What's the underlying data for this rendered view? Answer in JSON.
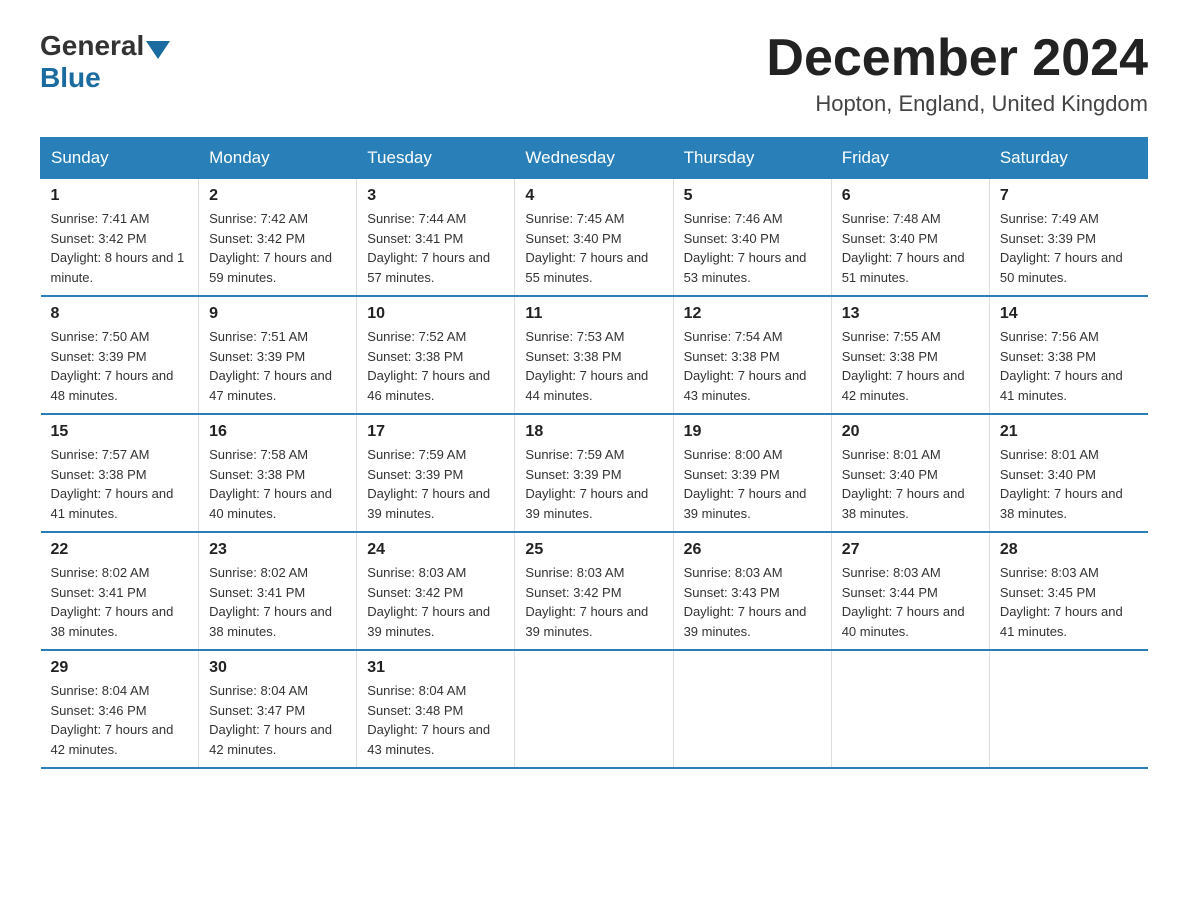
{
  "header": {
    "logo_general": "General",
    "logo_blue": "Blue",
    "month_title": "December 2024",
    "location": "Hopton, England, United Kingdom"
  },
  "days_of_week": [
    "Sunday",
    "Monday",
    "Tuesday",
    "Wednesday",
    "Thursday",
    "Friday",
    "Saturday"
  ],
  "weeks": [
    [
      {
        "day": "1",
        "sunrise": "7:41 AM",
        "sunset": "3:42 PM",
        "daylight": "8 hours and 1 minute."
      },
      {
        "day": "2",
        "sunrise": "7:42 AM",
        "sunset": "3:42 PM",
        "daylight": "7 hours and 59 minutes."
      },
      {
        "day": "3",
        "sunrise": "7:44 AM",
        "sunset": "3:41 PM",
        "daylight": "7 hours and 57 minutes."
      },
      {
        "day": "4",
        "sunrise": "7:45 AM",
        "sunset": "3:40 PM",
        "daylight": "7 hours and 55 minutes."
      },
      {
        "day": "5",
        "sunrise": "7:46 AM",
        "sunset": "3:40 PM",
        "daylight": "7 hours and 53 minutes."
      },
      {
        "day": "6",
        "sunrise": "7:48 AM",
        "sunset": "3:40 PM",
        "daylight": "7 hours and 51 minutes."
      },
      {
        "day": "7",
        "sunrise": "7:49 AM",
        "sunset": "3:39 PM",
        "daylight": "7 hours and 50 minutes."
      }
    ],
    [
      {
        "day": "8",
        "sunrise": "7:50 AM",
        "sunset": "3:39 PM",
        "daylight": "7 hours and 48 minutes."
      },
      {
        "day": "9",
        "sunrise": "7:51 AM",
        "sunset": "3:39 PM",
        "daylight": "7 hours and 47 minutes."
      },
      {
        "day": "10",
        "sunrise": "7:52 AM",
        "sunset": "3:38 PM",
        "daylight": "7 hours and 46 minutes."
      },
      {
        "day": "11",
        "sunrise": "7:53 AM",
        "sunset": "3:38 PM",
        "daylight": "7 hours and 44 minutes."
      },
      {
        "day": "12",
        "sunrise": "7:54 AM",
        "sunset": "3:38 PM",
        "daylight": "7 hours and 43 minutes."
      },
      {
        "day": "13",
        "sunrise": "7:55 AM",
        "sunset": "3:38 PM",
        "daylight": "7 hours and 42 minutes."
      },
      {
        "day": "14",
        "sunrise": "7:56 AM",
        "sunset": "3:38 PM",
        "daylight": "7 hours and 41 minutes."
      }
    ],
    [
      {
        "day": "15",
        "sunrise": "7:57 AM",
        "sunset": "3:38 PM",
        "daylight": "7 hours and 41 minutes."
      },
      {
        "day": "16",
        "sunrise": "7:58 AM",
        "sunset": "3:38 PM",
        "daylight": "7 hours and 40 minutes."
      },
      {
        "day": "17",
        "sunrise": "7:59 AM",
        "sunset": "3:39 PM",
        "daylight": "7 hours and 39 minutes."
      },
      {
        "day": "18",
        "sunrise": "7:59 AM",
        "sunset": "3:39 PM",
        "daylight": "7 hours and 39 minutes."
      },
      {
        "day": "19",
        "sunrise": "8:00 AM",
        "sunset": "3:39 PM",
        "daylight": "7 hours and 39 minutes."
      },
      {
        "day": "20",
        "sunrise": "8:01 AM",
        "sunset": "3:40 PM",
        "daylight": "7 hours and 38 minutes."
      },
      {
        "day": "21",
        "sunrise": "8:01 AM",
        "sunset": "3:40 PM",
        "daylight": "7 hours and 38 minutes."
      }
    ],
    [
      {
        "day": "22",
        "sunrise": "8:02 AM",
        "sunset": "3:41 PM",
        "daylight": "7 hours and 38 minutes."
      },
      {
        "day": "23",
        "sunrise": "8:02 AM",
        "sunset": "3:41 PM",
        "daylight": "7 hours and 38 minutes."
      },
      {
        "day": "24",
        "sunrise": "8:03 AM",
        "sunset": "3:42 PM",
        "daylight": "7 hours and 39 minutes."
      },
      {
        "day": "25",
        "sunrise": "8:03 AM",
        "sunset": "3:42 PM",
        "daylight": "7 hours and 39 minutes."
      },
      {
        "day": "26",
        "sunrise": "8:03 AM",
        "sunset": "3:43 PM",
        "daylight": "7 hours and 39 minutes."
      },
      {
        "day": "27",
        "sunrise": "8:03 AM",
        "sunset": "3:44 PM",
        "daylight": "7 hours and 40 minutes."
      },
      {
        "day": "28",
        "sunrise": "8:03 AM",
        "sunset": "3:45 PM",
        "daylight": "7 hours and 41 minutes."
      }
    ],
    [
      {
        "day": "29",
        "sunrise": "8:04 AM",
        "sunset": "3:46 PM",
        "daylight": "7 hours and 42 minutes."
      },
      {
        "day": "30",
        "sunrise": "8:04 AM",
        "sunset": "3:47 PM",
        "daylight": "7 hours and 42 minutes."
      },
      {
        "day": "31",
        "sunrise": "8:04 AM",
        "sunset": "3:48 PM",
        "daylight": "7 hours and 43 minutes."
      },
      null,
      null,
      null,
      null
    ]
  ]
}
